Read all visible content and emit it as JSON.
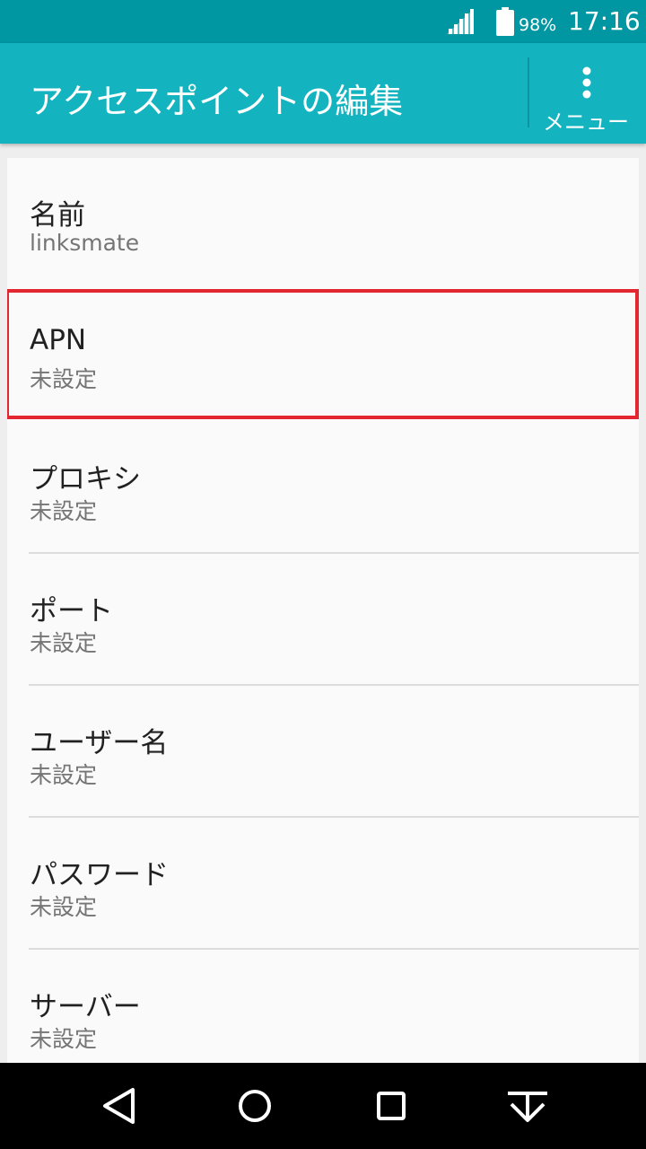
{
  "status_bar": {
    "battery_percent": "98%",
    "time": "17:16",
    "icons": [
      "signal-icon",
      "battery-icon"
    ]
  },
  "app_bar": {
    "title": "アクセスポイントの編集",
    "menu_label": "メニュー",
    "menu_icon": "more-vert-icon"
  },
  "settings": {
    "items": [
      {
        "title": "名前",
        "summary": "linksmate"
      },
      {
        "title": "APN",
        "summary": "未設定",
        "highlighted": true
      },
      {
        "title": "プロキシ",
        "summary": "未設定"
      },
      {
        "title": "ポート",
        "summary": "未設定"
      },
      {
        "title": "ユーザー名",
        "summary": "未設定"
      },
      {
        "title": "パスワード",
        "summary": "未設定"
      },
      {
        "title": "サーバー",
        "summary": "未設定"
      }
    ]
  },
  "colors": {
    "status_bar": "#0096a2",
    "app_bar": "#13b4c0",
    "highlight": "#e32730"
  },
  "nav_bar": {
    "icons": [
      "back-icon",
      "home-icon",
      "recents-icon",
      "hide-nav-icon"
    ]
  }
}
